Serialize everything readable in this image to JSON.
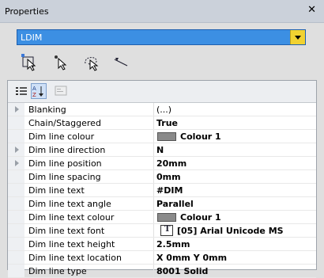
{
  "window": {
    "title": "Properties"
  },
  "selector": {
    "value": "LDIM"
  },
  "toolbar_icons": [
    "select-add-icon",
    "pick-point-icon",
    "lasso-select-icon",
    "line-pick-icon"
  ],
  "grid_toolbar": [
    "categorized-icon",
    "alphabetical-sort-icon",
    "property-pages-icon"
  ],
  "properties": [
    {
      "name": "Blanking",
      "value": "(...)",
      "expandable": true,
      "kind": "plain"
    },
    {
      "name": "Chain/Staggered",
      "value": "True",
      "expandable": false,
      "kind": "text"
    },
    {
      "name": "Dim line colour",
      "value": "Colour 1",
      "expandable": false,
      "kind": "swatch"
    },
    {
      "name": "Dim line direction",
      "value": "N",
      "expandable": true,
      "kind": "text"
    },
    {
      "name": "Dim line position",
      "value": "20mm",
      "expandable": true,
      "kind": "text"
    },
    {
      "name": "Dim line spacing",
      "value": "0mm",
      "expandable": false,
      "kind": "text"
    },
    {
      "name": "Dim line text",
      "value": "#DIM",
      "expandable": false,
      "kind": "text"
    },
    {
      "name": "Dim line text angle",
      "value": "Parallel",
      "expandable": false,
      "kind": "text"
    },
    {
      "name": "Dim line text colour",
      "value": "Colour 1",
      "expandable": false,
      "kind": "swatch"
    },
    {
      "name": "Dim line text font",
      "value": "[05] Arial Unicode MS",
      "expandable": false,
      "kind": "font"
    },
    {
      "name": "Dim line text height",
      "value": "2.5mm",
      "expandable": false,
      "kind": "text"
    },
    {
      "name": "Dim line text location",
      "value": "X 0mm Y 0mm",
      "expandable": false,
      "kind": "text"
    },
    {
      "name": "Dim line type",
      "value": "8001 Solid",
      "expandable": false,
      "kind": "text"
    }
  ]
}
